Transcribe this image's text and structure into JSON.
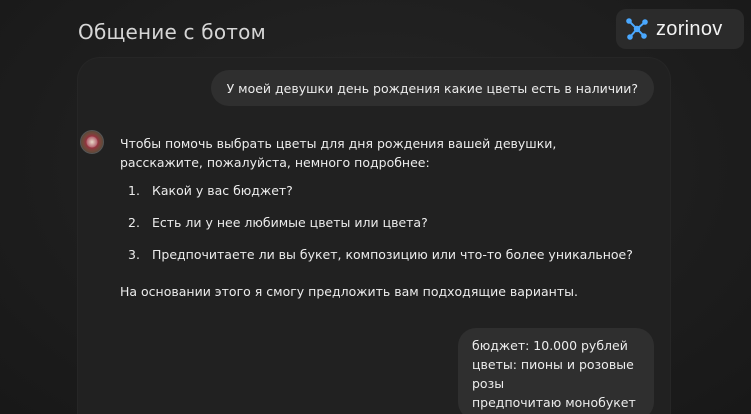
{
  "header": {
    "title": "Общение с ботом",
    "logo_text": "zorinov",
    "logo_icon": "molecule-network-icon",
    "logo_color": "#4aa8ff"
  },
  "chat": {
    "user_message_1": "У моей девушки день рождения какие цветы есть в наличии?",
    "bot_avatar": "flower-bouquet-avatar",
    "bot_reply": {
      "intro": "Чтобы помочь выбрать цветы для дня рождения вашей девушки, расскажите, пожалуйста, немного подробнее:",
      "questions": [
        {
          "num": "1.",
          "text": "Какой у вас бюджет?"
        },
        {
          "num": "2.",
          "text": "Есть ли у нее любимые цветы или цвета?"
        },
        {
          "num": "3.",
          "text": "Предпочитаете ли вы букет, композицию или что-то более уникальное?"
        }
      ],
      "outro": "На основании этого я смогу предложить вам подходящие варианты."
    },
    "user_message_2": {
      "lines": [
        "бюджет: 10.000 рублей",
        "цветы: пионы и розовые розы",
        "предпочитаю монобукет"
      ]
    }
  }
}
